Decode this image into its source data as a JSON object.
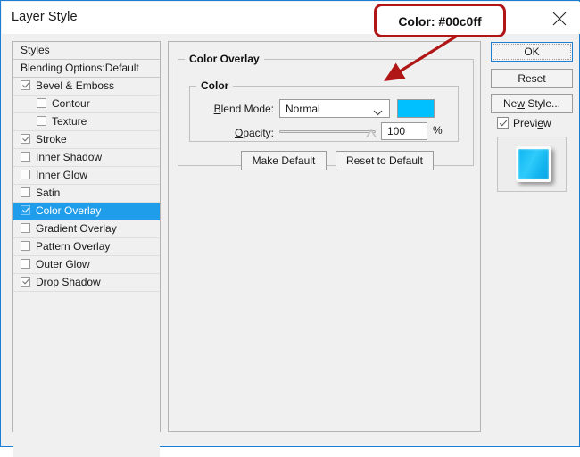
{
  "window": {
    "title": "Layer Style",
    "close_icon": "close-icon"
  },
  "styles_panel": {
    "header": "Styles",
    "blending_options": "Blending Options:Default",
    "items": [
      {
        "label": "Bevel & Emboss",
        "checked": true,
        "indent": false,
        "selected": false
      },
      {
        "label": "Contour",
        "checked": false,
        "indent": true,
        "selected": false
      },
      {
        "label": "Texture",
        "checked": false,
        "indent": true,
        "selected": false
      },
      {
        "label": "Stroke",
        "checked": true,
        "indent": false,
        "selected": false
      },
      {
        "label": "Inner Shadow",
        "checked": false,
        "indent": false,
        "selected": false
      },
      {
        "label": "Inner Glow",
        "checked": false,
        "indent": false,
        "selected": false
      },
      {
        "label": "Satin",
        "checked": false,
        "indent": false,
        "selected": false
      },
      {
        "label": "Color Overlay",
        "checked": true,
        "indent": false,
        "selected": true
      },
      {
        "label": "Gradient Overlay",
        "checked": false,
        "indent": false,
        "selected": false
      },
      {
        "label": "Pattern Overlay",
        "checked": false,
        "indent": false,
        "selected": false
      },
      {
        "label": "Outer Glow",
        "checked": false,
        "indent": false,
        "selected": false
      },
      {
        "label": "Drop Shadow",
        "checked": true,
        "indent": false,
        "selected": false
      }
    ]
  },
  "main_panel": {
    "group_title": "Color Overlay",
    "color_group_title": "Color",
    "blend_mode_label": "Blend Mode:",
    "blend_mode_label_mnemonic": "B",
    "blend_mode_label_rest": "lend Mode:",
    "blend_mode_value": "Normal",
    "blend_mode_chevron": "chevron-down-icon",
    "color_swatch_value": "#00c0ff",
    "opacity_label_mnemonic": "O",
    "opacity_label_rest": "pacity:",
    "opacity_value": "100",
    "opacity_unit": "%",
    "make_default_label": "Make Default",
    "reset_to_default_label": "Reset to Default"
  },
  "buttons": {
    "ok": "OK",
    "reset": "Reset",
    "new_style_mnemonic": "w",
    "new_style_before": "Ne",
    "new_style_after": " Style...",
    "preview_mnemonic": "e",
    "preview_before": "Previ",
    "preview_after": "w",
    "preview_checked": true
  },
  "annotation": {
    "text": "Color: #00c0ff",
    "border_color": "#b01616",
    "arrow_color": "#b01616"
  },
  "colors": {
    "swatch": "#00c0ff",
    "selection": "#1f9cea",
    "window_border": "#1a7fd4",
    "panel_bg": "#f0f0f0"
  }
}
